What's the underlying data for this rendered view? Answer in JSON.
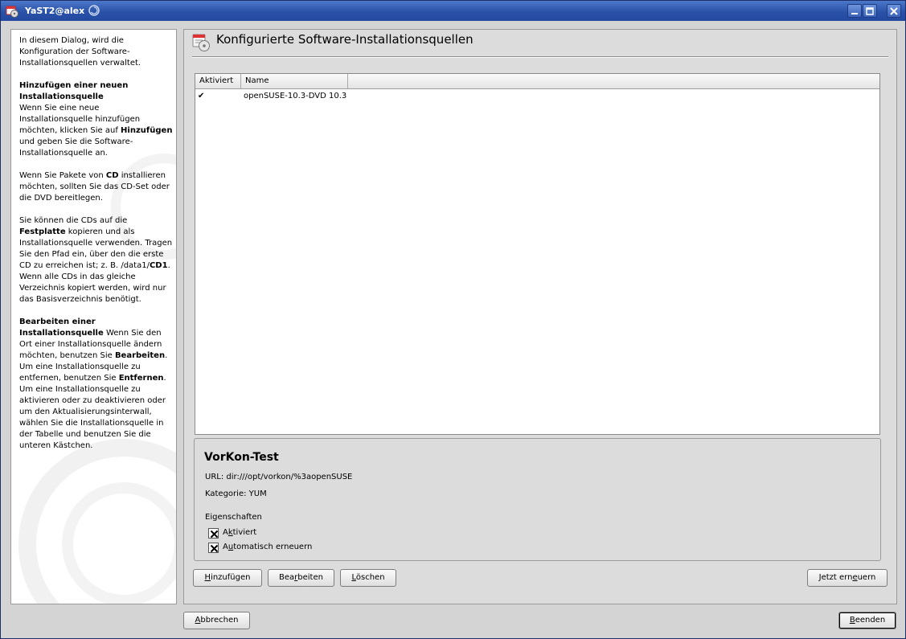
{
  "window": {
    "title": "YaST2@alex"
  },
  "help": {
    "intro": "In diesem Dialog, wird die Konfiguration der Software-Installationsquellen verwaltet.",
    "add_heading": "Hinzufügen einer neuen Installationsquelle",
    "add_text_1": "Wenn Sie eine neue Installationsquelle hinzufügen möchten, klicken Sie auf ",
    "add_bold": "Hinzufügen",
    "add_text_2": " und geben Sie die Software-Installationsquelle an.",
    "cd_text_1": "Wenn Sie Pakete von ",
    "cd_bold": "CD",
    "cd_text_2": " installieren möchten, sollten Sie das CD-Set oder die DVD bereitlegen.",
    "hd_text_1": "Sie können die CDs auf die ",
    "hd_bold_1": "Festplatte",
    "hd_text_2": " kopieren und als Installationsquelle verwenden. Tragen Sie den Pfad ein, über den die erste CD zu erreichen ist; z. B. /data1/",
    "hd_bold_2": "CD1",
    "hd_text_3": ". Wenn alle CDs in das gleiche Verzeichnis kopiert werden, wird nur das Basisverzeichnis benötigt.",
    "edit_heading": "Bearbeiten einer Installationsquelle",
    "edit_text_1": " Wenn Sie den Ort einer Installationsquelle ändern möchten, benutzen Sie ",
    "edit_bold_1": "Bearbeiten",
    "edit_text_2": ". Um eine Installationsquelle zu entfernen, benutzen Sie ",
    "edit_bold_2": "Entfernen",
    "edit_text_3": ". Um eine Installationsquelle zu aktivieren oder zu deaktivieren oder um den Aktualisierungsinterwall, wählen Sie die Installationsquelle in der Tabelle und benutzen Sie die unteren Kästchen."
  },
  "main": {
    "heading": "Konfigurierte Software-Installationsquellen",
    "table": {
      "columns": [
        "Aktiviert",
        "Name"
      ],
      "rows": [
        {
          "enabled": "✔",
          "name": "openSUSE-10.3-DVD 10.3"
        }
      ]
    },
    "details": {
      "name": "VorKon-Test",
      "url": "URL: dir:///opt/vorkon/%3aopenSUSE",
      "category": "Kategorie: YUM",
      "properties_label": "Eigenschaften",
      "enabled_a": "A",
      "enabled_k": "k",
      "enabled_rest": "tiviert",
      "enabled_checked": true,
      "autorefresh_a": "A",
      "autorefresh_u": "u",
      "autorefresh_rest": "tomatisch erneuern",
      "autorefresh_checked": true
    },
    "buttons": {
      "add_u": "H",
      "add_rest": "inzufügen",
      "edit_pre": "Bea",
      "edit_u": "r",
      "edit_rest": "beiten",
      "delete_pre": "",
      "delete_u": "L",
      "delete_rest": "öschen",
      "refresh_pre": "Jetzt ern",
      "refresh_u": "e",
      "refresh_rest": "uern"
    }
  },
  "footer": {
    "cancel_u": "A",
    "cancel_rest": "bbrechen",
    "finish_u": "B",
    "finish_rest": "eenden"
  }
}
